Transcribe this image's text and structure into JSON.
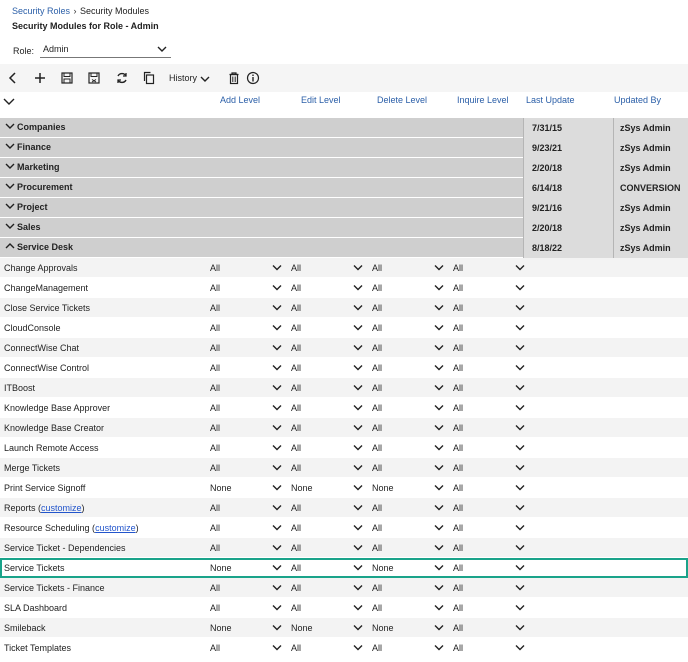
{
  "breadcrumb": {
    "root": "Security Roles",
    "current": "Security Modules"
  },
  "page_title": "Security Modules for Role - Admin",
  "role": {
    "label": "Role:",
    "value": "Admin"
  },
  "toolbar": {
    "history_label": "History"
  },
  "columns": {
    "add": "Add Level",
    "edit": "Edit Level",
    "delete": "Delete Level",
    "inquire": "Inquire Level",
    "last_update": "Last Update",
    "updated_by": "Updated By"
  },
  "groups": [
    {
      "name": "Companies",
      "last_update": "7/31/15",
      "updated_by": "zSys Admin"
    },
    {
      "name": "Finance",
      "last_update": "9/23/21",
      "updated_by": "zSys Admin"
    },
    {
      "name": "Marketing",
      "last_update": "2/20/18",
      "updated_by": "zSys Admin"
    },
    {
      "name": "Procurement",
      "last_update": "6/14/18",
      "updated_by": "CONVERSION"
    },
    {
      "name": "Project",
      "last_update": "9/21/16",
      "updated_by": "zSys Admin"
    },
    {
      "name": "Sales",
      "last_update": "2/20/18",
      "updated_by": "zSys Admin"
    },
    {
      "name": "Service Desk",
      "last_update": "8/18/22",
      "updated_by": "zSys Admin"
    }
  ],
  "modules": [
    {
      "name": "Change Approvals",
      "add": "All",
      "edit": "All",
      "delete": "All",
      "inquire": "All"
    },
    {
      "name": "ChangeManagement",
      "add": "All",
      "edit": "All",
      "delete": "All",
      "inquire": "All"
    },
    {
      "name": "Close Service Tickets",
      "add": "All",
      "edit": "All",
      "delete": "All",
      "inquire": "All"
    },
    {
      "name": "CloudConsole",
      "add": "All",
      "edit": "All",
      "delete": "All",
      "inquire": "All"
    },
    {
      "name": "ConnectWise Chat",
      "add": "All",
      "edit": "All",
      "delete": "All",
      "inquire": "All"
    },
    {
      "name": "ConnectWise Control",
      "add": "All",
      "edit": "All",
      "delete": "All",
      "inquire": "All"
    },
    {
      "name": "ITBoost",
      "add": "All",
      "edit": "All",
      "delete": "All",
      "inquire": "All"
    },
    {
      "name": "Knowledge Base Approver",
      "add": "All",
      "edit": "All",
      "delete": "All",
      "inquire": "All"
    },
    {
      "name": "Knowledge Base Creator",
      "add": "All",
      "edit": "All",
      "delete": "All",
      "inquire": "All"
    },
    {
      "name": "Launch Remote Access",
      "add": "All",
      "edit": "All",
      "delete": "All",
      "inquire": "All"
    },
    {
      "name": "Merge Tickets",
      "add": "All",
      "edit": "All",
      "delete": "All",
      "inquire": "All"
    },
    {
      "name": "Print Service Signoff",
      "add": "None",
      "edit": "None",
      "delete": "None",
      "inquire": "All"
    },
    {
      "name": "Reports (",
      "link": "customize",
      "suffix": ")",
      "add": "All",
      "edit": "All",
      "delete": "All",
      "inquire": "All"
    },
    {
      "name": "Resource Scheduling (",
      "link": "customize",
      "suffix": ")",
      "add": "All",
      "edit": "All",
      "delete": "All",
      "inquire": "All"
    },
    {
      "name": "Service Ticket - Dependencies",
      "add": "All",
      "edit": "All",
      "delete": "All",
      "inquire": "All"
    },
    {
      "name": "Service Tickets",
      "add": "None",
      "edit": "All",
      "delete": "None",
      "inquire": "All",
      "highlighted": true
    },
    {
      "name": "Service Tickets - Finance",
      "add": "All",
      "edit": "All",
      "delete": "All",
      "inquire": "All"
    },
    {
      "name": "SLA Dashboard",
      "add": "All",
      "edit": "All",
      "delete": "All",
      "inquire": "All"
    },
    {
      "name": "Smileback",
      "add": "None",
      "edit": "None",
      "delete": "None",
      "inquire": "All"
    },
    {
      "name": "Ticket Templates",
      "add": "All",
      "edit": "All",
      "delete": "All",
      "inquire": "All"
    }
  ]
}
